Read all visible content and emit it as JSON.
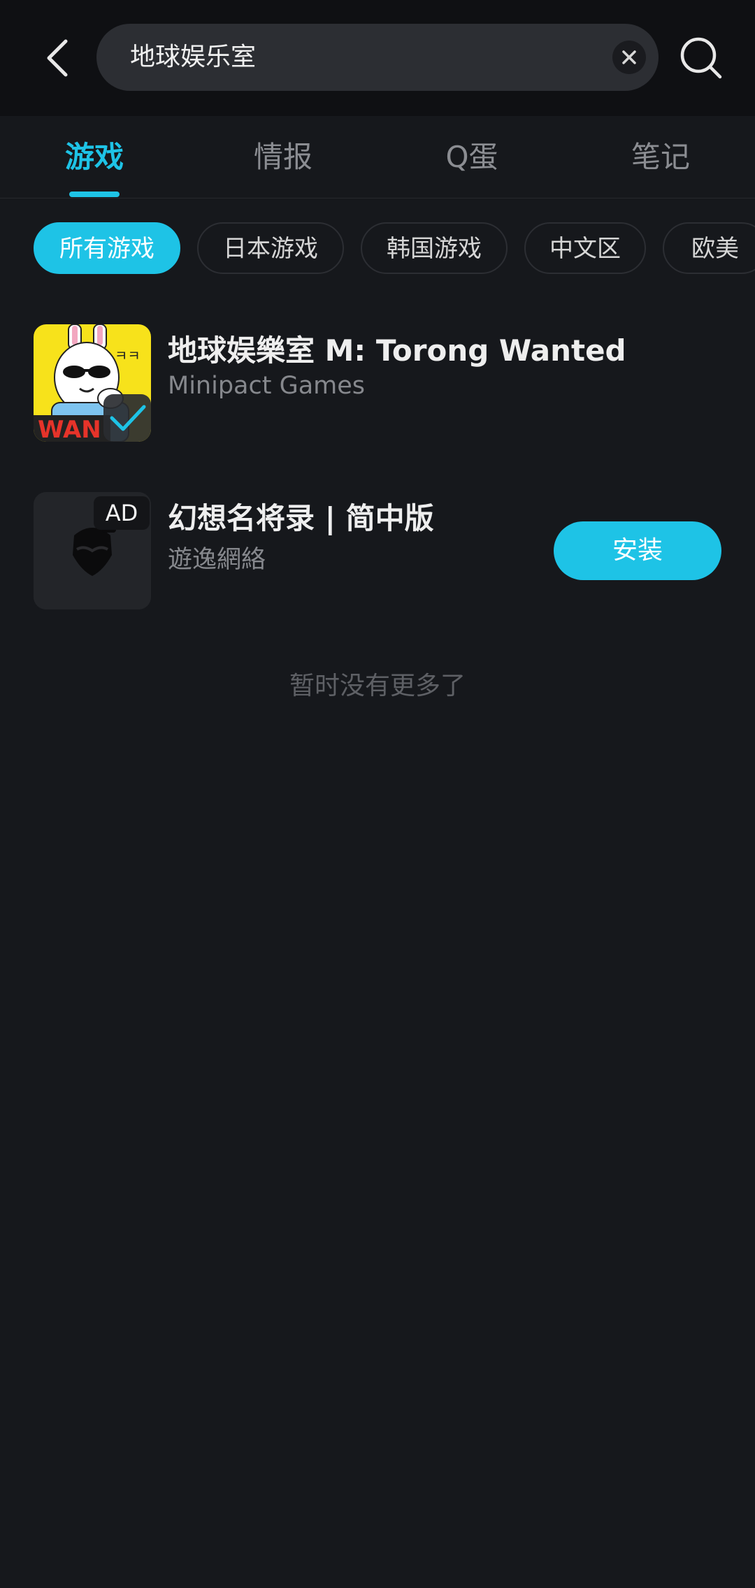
{
  "search": {
    "query": "地球娱乐室"
  },
  "tabs": [
    {
      "label": "游戏",
      "active": true
    },
    {
      "label": "情报",
      "active": false
    },
    {
      "label": "Q蛋",
      "active": false
    },
    {
      "label": "笔记",
      "active": false
    }
  ],
  "filters": [
    {
      "label": "所有游戏",
      "active": true
    },
    {
      "label": "日本游戏",
      "active": false
    },
    {
      "label": "韩国游戏",
      "active": false
    },
    {
      "label": "中文区",
      "active": false
    },
    {
      "label": "欧美",
      "active": false
    }
  ],
  "results": [
    {
      "title": "地球娱樂室 M: Torong Wanted",
      "developer": "Minipact Games",
      "icon_text": "WAN",
      "icon_small_text": "ㅋㅋ",
      "installed": true
    },
    {
      "title": "幻想名将录 | 简中版",
      "developer": "遊逸網絡",
      "ad_label": "AD",
      "install_label": "安装"
    }
  ],
  "footer": {
    "no_more": "暂时没有更多了"
  },
  "colors": {
    "accent": "#1ec3e6",
    "background": "#16181c",
    "topbar": "#0f1013"
  }
}
